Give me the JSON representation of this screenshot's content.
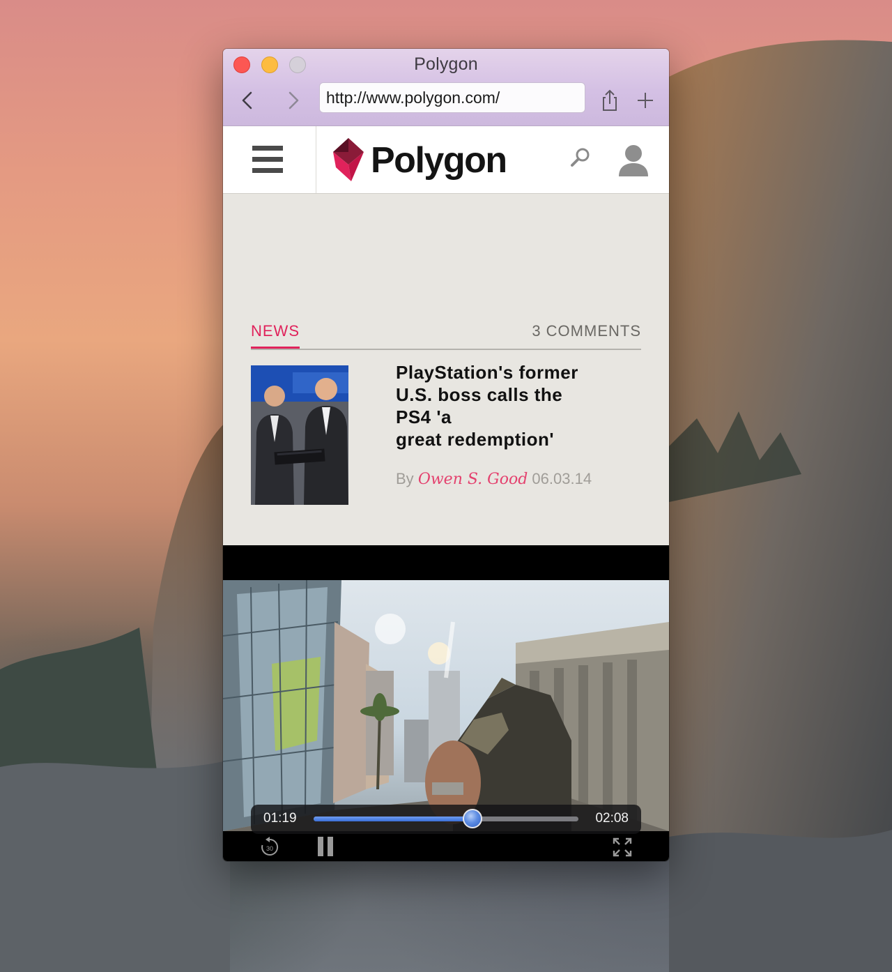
{
  "window": {
    "title": "Polygon",
    "url": "http://www.polygon.com/"
  },
  "toolbar": {
    "back_icon": "chevron-left-icon",
    "forward_icon": "chevron-right-icon",
    "share_icon": "share-icon",
    "new_tab_icon": "plus-icon"
  },
  "site": {
    "name": "Polygon",
    "brand_color": "#e0225b"
  },
  "article": {
    "category": "NEWS",
    "comments": "3 COMMENTS",
    "headline_lines": [
      "PlayStation's former",
      "U.S. boss calls the",
      "PS4 'a",
      "great redemption'"
    ],
    "by": "By",
    "author": "Owen S. Good",
    "date": "06.03.14"
  },
  "video": {
    "current_time": "01:19",
    "duration": "02:08",
    "progress": 0.6,
    "skip_label": "30"
  }
}
